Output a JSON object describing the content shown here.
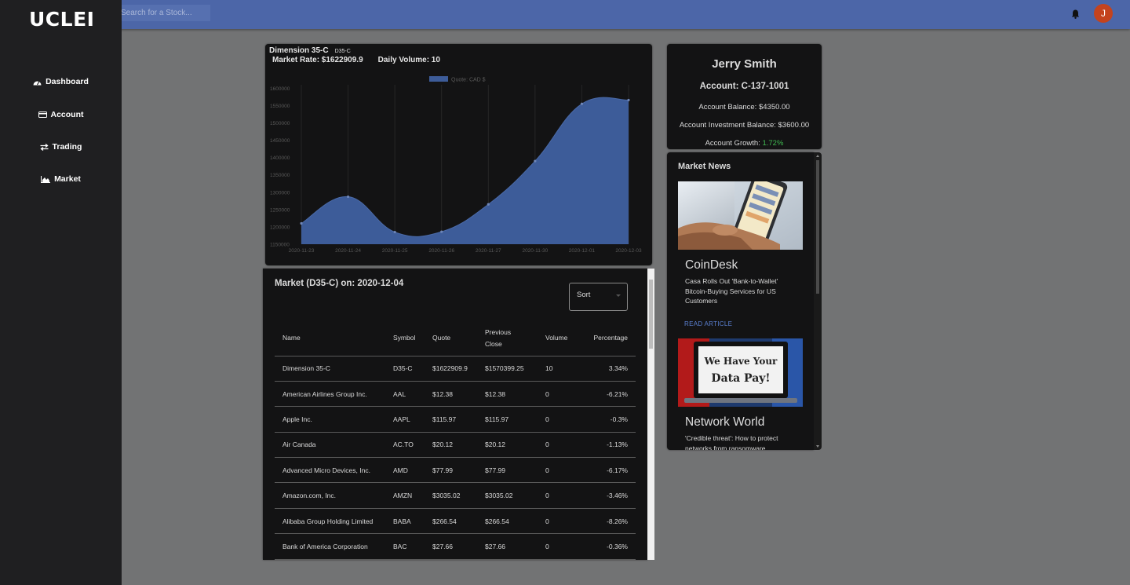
{
  "app": {
    "logo": "UCLEI",
    "search_placeholder": "Search for a Stock...",
    "avatar_initial": "J"
  },
  "sidebar": {
    "items": [
      {
        "label": "Dashboard",
        "icon": "dashboard-icon"
      },
      {
        "label": "Account",
        "icon": "credit-card-icon"
      },
      {
        "label": "Trading",
        "icon": "exchange-icon"
      },
      {
        "label": "Market",
        "icon": "area-chart-icon"
      }
    ]
  },
  "stock": {
    "name": "Dimension 35-C",
    "symbol": "D35-C",
    "market_rate": "Market Rate: $1622909.9",
    "daily_volume": "Daily Volume: 10"
  },
  "chart_data": {
    "type": "area",
    "legend": [
      "Quote: CAD $"
    ],
    "x": [
      "2020-11-23",
      "2020-11-24",
      "2020-11-25",
      "2020-11-26",
      "2020-11-27",
      "2020-11-30",
      "2020-12-01",
      "2020-12-03"
    ],
    "series": [
      {
        "name": "Quote: CAD $",
        "values": [
          1210000,
          1287000,
          1185000,
          1186000,
          1265000,
          1390000,
          1555000,
          1566000
        ]
      }
    ],
    "yticks": [
      1150000,
      1200000,
      1250000,
      1300000,
      1350000,
      1400000,
      1450000,
      1500000,
      1550000,
      1600000
    ],
    "ylim": [
      1150000,
      1610000
    ],
    "colors": {
      "fill": "#3d5c99",
      "point": "#6f86b8"
    }
  },
  "market_table": {
    "title": "Market (D35-C) on: 2020-12-04",
    "sort_label": "Sort",
    "headers": {
      "name": "Name",
      "symbol": "Symbol",
      "quote": "Quote",
      "prev_line1": "Previous",
      "prev_line2": "Close",
      "volume": "Volume",
      "percentage": "Percentage"
    },
    "rows": [
      {
        "name": "Dimension 35-C",
        "symbol": "D35-C",
        "quote": "$1622909.9",
        "prev": "$1570399.25",
        "volume": "10",
        "pct": "3.34%"
      },
      {
        "name": "American Airlines Group Inc.",
        "symbol": "AAL",
        "quote": "$12.38",
        "prev": "$12.38",
        "volume": "0",
        "pct": "-6.21%"
      },
      {
        "name": "Apple Inc.",
        "symbol": "AAPL",
        "quote": "$115.97",
        "prev": "$115.97",
        "volume": "0",
        "pct": "-0.3%"
      },
      {
        "name": "Air Canada",
        "symbol": "AC.TO",
        "quote": "$20.12",
        "prev": "$20.12",
        "volume": "0",
        "pct": "-1.13%"
      },
      {
        "name": "Advanced Micro Devices, Inc.",
        "symbol": "AMD",
        "quote": "$77.99",
        "prev": "$77.99",
        "volume": "0",
        "pct": "-6.17%"
      },
      {
        "name": "Amazon.com, Inc.",
        "symbol": "AMZN",
        "quote": "$3035.02",
        "prev": "$3035.02",
        "volume": "0",
        "pct": "-3.46%"
      },
      {
        "name": "Alibaba Group Holding Limited",
        "symbol": "BABA",
        "quote": "$266.54",
        "prev": "$266.54",
        "volume": "0",
        "pct": "-8.26%"
      },
      {
        "name": "Bank of America Corporation",
        "symbol": "BAC",
        "quote": "$27.66",
        "prev": "$27.66",
        "volume": "0",
        "pct": "-0.36%"
      }
    ]
  },
  "account": {
    "name": "Jerry Smith",
    "id_line": "Account: C-137-1001",
    "balance": "Account Balance: $4350.00",
    "investment": "Account Investment Balance: $3600.00",
    "growth_label": "Account Growth: ",
    "growth_value": "1.72%"
  },
  "news": {
    "title": "Market News",
    "read_label": "READ ARTICLE",
    "items": [
      {
        "source": "CoinDesk",
        "headline": "Casa Rolls Out 'Bank-to-Wallet' Bitcoin-Buying Services for US Customers"
      },
      {
        "source": "Network World",
        "headline": "'Credible threat': How to protect networks from ransomware"
      }
    ],
    "image2_text": "We Have Your Data Pay!"
  }
}
